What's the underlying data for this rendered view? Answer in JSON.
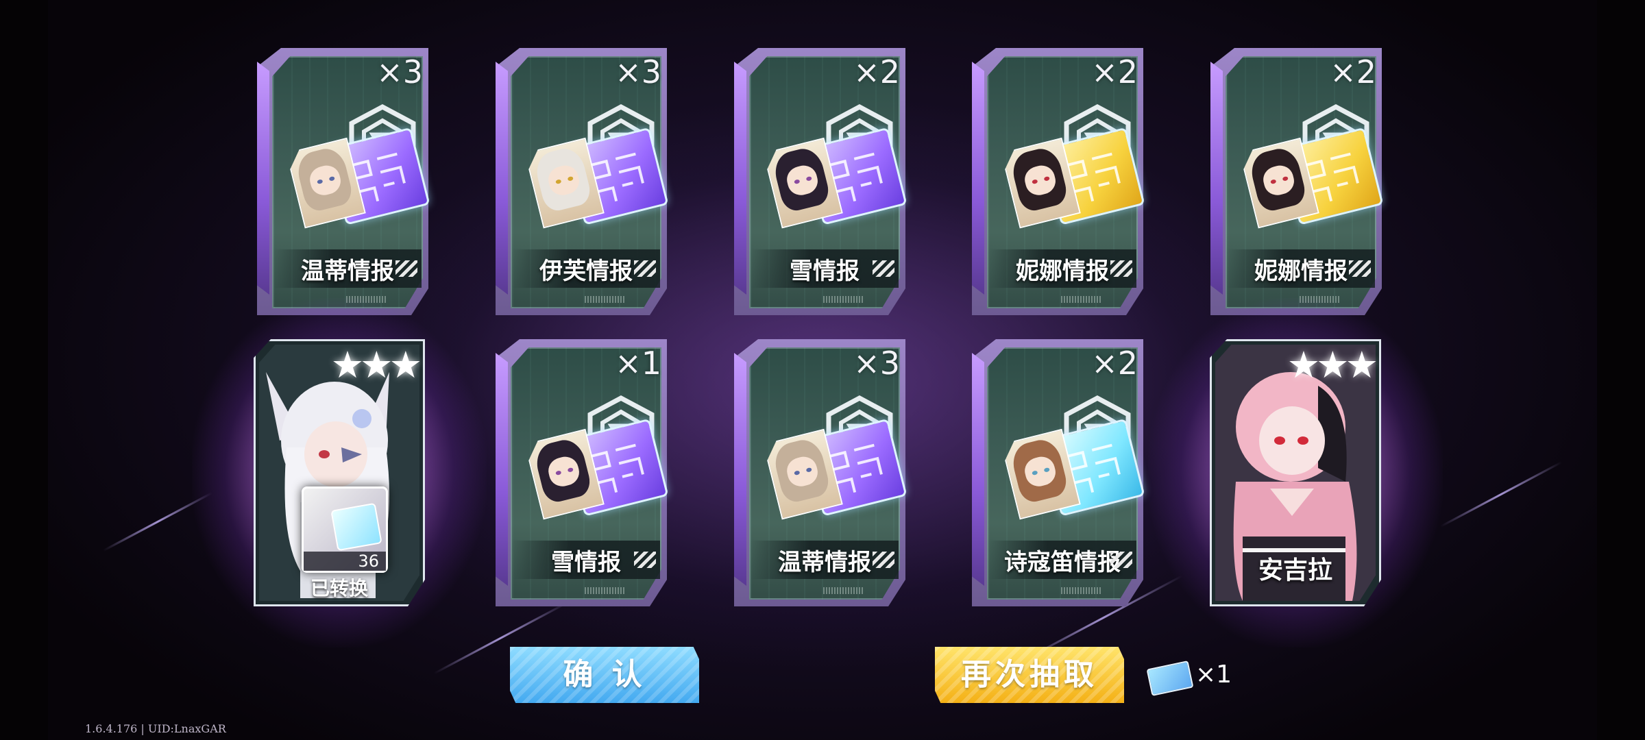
{
  "cards_row1": [
    {
      "name": "温蒂情报",
      "count": "×3",
      "chip": "purple",
      "hair": "#c4b09a",
      "eye": "#5a6aa6"
    },
    {
      "name": "伊芙情报",
      "count": "×3",
      "chip": "purple",
      "hair": "#e8e4de",
      "eye": "#d2a530"
    },
    {
      "name": "雪情报",
      "count": "×2",
      "chip": "purple",
      "hair": "#2a2030",
      "eye": "#8a4aa0"
    },
    {
      "name": "妮娜情报",
      "count": "×2",
      "chip": "gold",
      "hair": "#2b1e22",
      "eye": "#c03040"
    },
    {
      "name": "妮娜情报",
      "count": "×2",
      "chip": "gold",
      "hair": "#2b1e22",
      "eye": "#c03040"
    }
  ],
  "cards_row2": [
    {
      "name": "雪情报",
      "count": "×1",
      "chip": "purple",
      "hair": "#2a2030",
      "eye": "#8a4aa0"
    },
    {
      "name": "温蒂情报",
      "count": "×3",
      "chip": "purple",
      "hair": "#c4b09a",
      "eye": "#5a6aa6"
    },
    {
      "name": "诗寇笛情报",
      "count": "×2",
      "chip": "cyan",
      "hair": "#a06a48",
      "eye": "#5aa0c0"
    }
  ],
  "character_left": {
    "stars": "★★★",
    "converted_count": "36",
    "converted_label": "已转换"
  },
  "character_right": {
    "stars": "★★★",
    "name": "安吉拉"
  },
  "buttons": {
    "confirm": "确 认",
    "redraw": "再次抽取"
  },
  "ticket": {
    "count": "×1"
  },
  "version_text": "1.6.4.176 | UID:LnaxGAR",
  "colors": {
    "confirm_button": "#5ab8f4",
    "redraw_button": "#f6c22e",
    "glow": "#d69cff"
  }
}
